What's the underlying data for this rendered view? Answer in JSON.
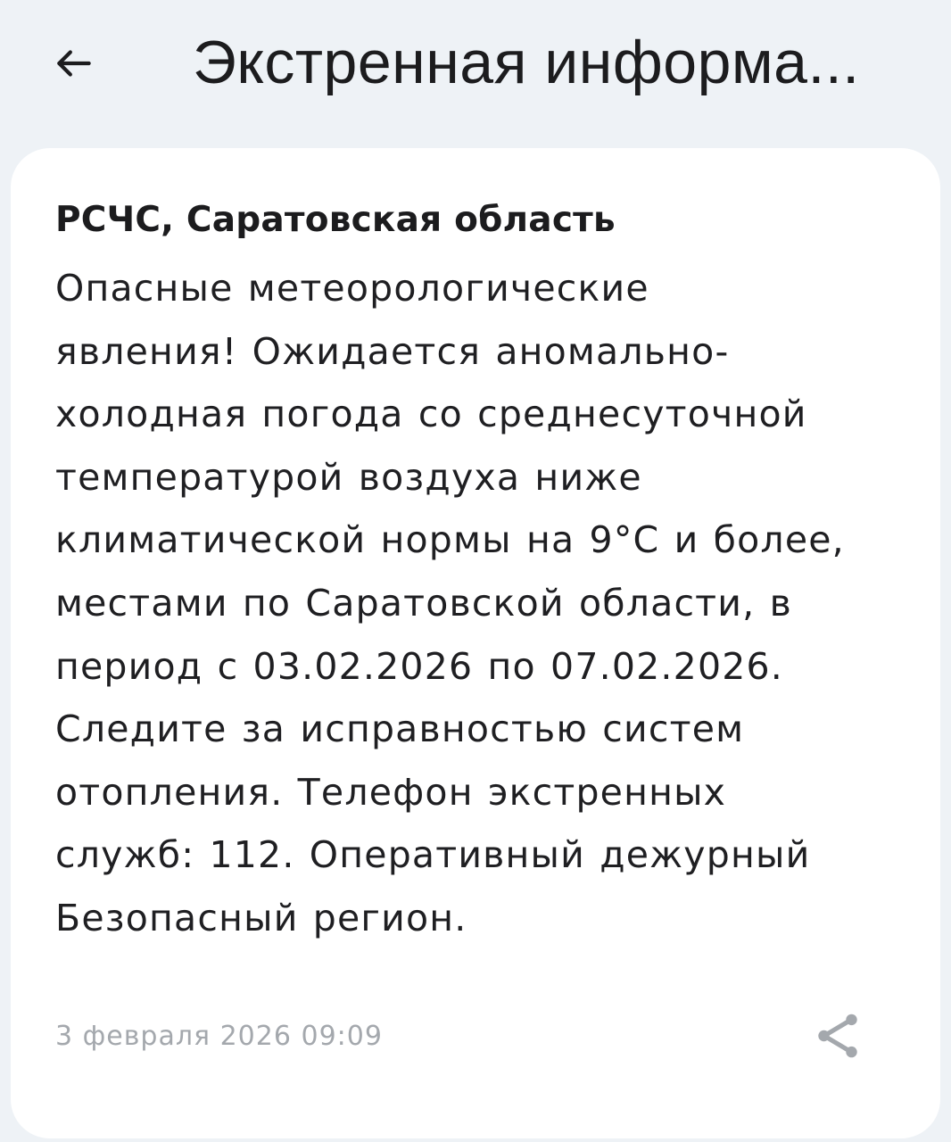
{
  "header": {
    "back_icon": "arrow-left-icon",
    "title": "Экстренная информа..."
  },
  "alert": {
    "source": "РСЧС, Саратовская область",
    "message_lines": [
      "Опасные метеорологические",
      "явления! Ожидается аномально-",
      "холодная погода со среднесуточной",
      "температурой воздуха ниже",
      "климатической нормы на 9°С и более,",
      "местами по Саратовской области, в",
      "период с 03.02.2026 по 07.02.2026.",
      "Следите за исправностью систем",
      "отопления. Телефон экстренных",
      "служб: 112. Оперативный дежурный",
      "Безопасный регион."
    ],
    "timestamp": "3 февраля 2026 09:09",
    "share_icon": "share-icon"
  },
  "colors": {
    "background": "#eef2f6",
    "card": "#ffffff",
    "text": "#1c1c1e",
    "muted": "#a4a8ad"
  }
}
